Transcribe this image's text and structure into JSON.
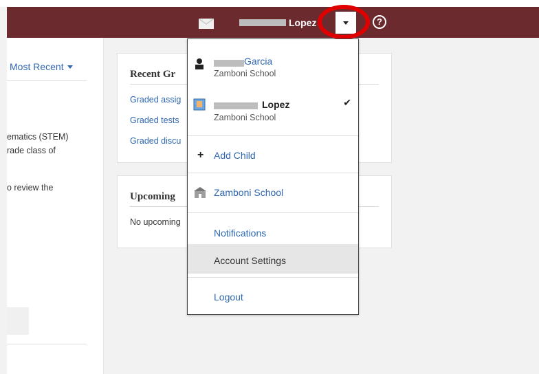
{
  "header": {
    "user_last_name": "Lopez",
    "help_glyph": "?",
    "icons": {
      "mail": "mail-icon",
      "dropdown": "chevron-down-icon",
      "help": "help-icon"
    },
    "accent": "#6b2a2e"
  },
  "left_panel": {
    "sort_label": "Most Recent",
    "snippets": [
      "ematics (STEM)",
      "rade class of",
      "o review the"
    ]
  },
  "cards": {
    "recent": {
      "title": "Recent Gr",
      "links": [
        "Graded assig",
        "Graded tests",
        "Graded discu"
      ]
    },
    "upcoming": {
      "title": "Upcoming",
      "empty_text": "No upcoming"
    }
  },
  "menu": {
    "child1": {
      "last_name": "Garcia",
      "school": "Zamboni School"
    },
    "child2": {
      "last_name": "Lopez",
      "school": "Zamboni School",
      "check": "✔"
    },
    "add_child": "Add Child",
    "school_link": "Zamboni School",
    "notifications": "Notifications",
    "account_settings": "Account Settings",
    "logout": "Logout",
    "colors": {
      "link": "#2f67b1",
      "hover": "#e6e6e6"
    }
  }
}
